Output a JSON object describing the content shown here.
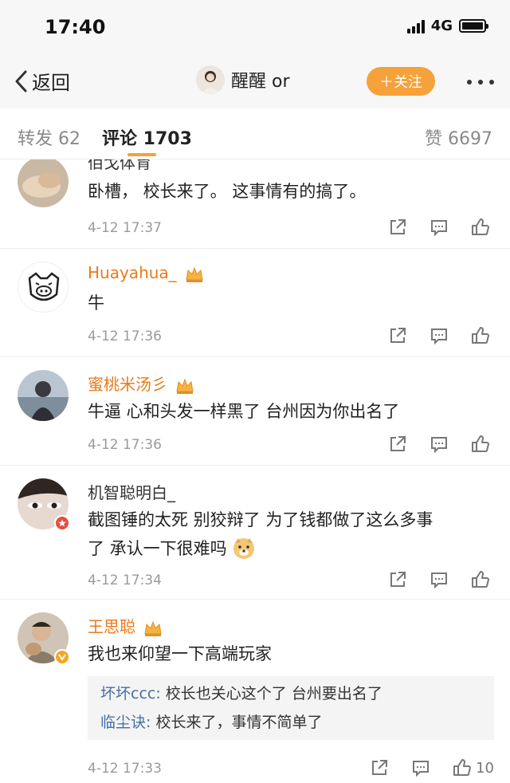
{
  "status": {
    "time": "17:40",
    "network": "4G"
  },
  "nav": {
    "back_label": "返回",
    "user_name": "醒醒 or",
    "follow_label": "＋关注"
  },
  "tabs": [
    {
      "label": "转发 62"
    },
    {
      "label": "评论 1703"
    },
    {
      "label": "赞 6697"
    }
  ],
  "comments": [
    {
      "name": "佰戈体育",
      "text": "卧槽， 校长来了。 这事情有的搞了。",
      "time": "4-12 17:37"
    },
    {
      "name": "Huayahua_",
      "text": "牛",
      "time": "4-12 17:36"
    },
    {
      "name": "蜜桃米汤彡",
      "text": "牛逼 心和头发一样黑了 台州因为你出名了",
      "time": "4-12 17:36"
    },
    {
      "name": "机智聪明白_",
      "text_line1": "截图锤的太死 别狡辩了 为了钱都做了这么多事",
      "text_line2": "了 承认一下很难吗",
      "time": "4-12 17:34"
    },
    {
      "name": "王思聪",
      "text": "我也来仰望一下高端玩家",
      "time": "4-12 17:33",
      "likes": "10",
      "replies": [
        {
          "name": "坏坏ccc:",
          "text": " 校长也关心这个了 台州要出名了"
        },
        {
          "name": "临尘诀:",
          "text": " 校长来了，事情不简单了"
        }
      ]
    }
  ],
  "colors": {
    "accent": "#f6a13a",
    "vip_name": "#e87b1c",
    "reply_name": "#466fa3",
    "meta": "#9a9a9a"
  }
}
